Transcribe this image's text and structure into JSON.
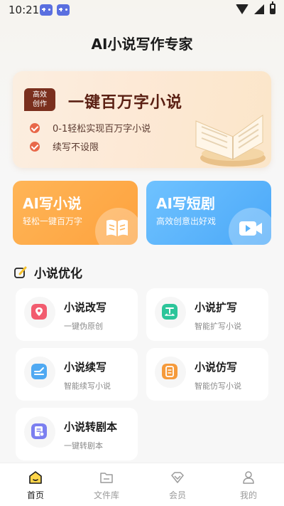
{
  "status": {
    "time": "10:21"
  },
  "header": {
    "title": "AI小说写作专家"
  },
  "banner": {
    "badge_line1": "高效",
    "badge_line2": "创作",
    "title": "一键百万字小说",
    "features": [
      "0-1轻松实现百万字小说",
      "续写不设限"
    ]
  },
  "cards": [
    {
      "title": "AI写小说",
      "subtitle": "轻松一键百万字",
      "icon": "book-icon"
    },
    {
      "title": "AI写短剧",
      "subtitle": "高效创意出好戏",
      "icon": "video-icon"
    }
  ],
  "section": {
    "title": "小说优化"
  },
  "tools": [
    {
      "name": "小说改写",
      "desc": "一键伪原创",
      "icon": "rewrite-icon",
      "color": "#f25c6f"
    },
    {
      "name": "小说扩写",
      "desc": "智能扩写小说",
      "icon": "expand-icon",
      "color": "#2cc59a"
    },
    {
      "name": "小说续写",
      "desc": "智能续写小说",
      "icon": "continue-icon",
      "color": "#4fa9f2"
    },
    {
      "name": "小说仿写",
      "desc": "智能仿写小说",
      "icon": "imitate-icon",
      "color": "#f59a3b"
    },
    {
      "name": "小说转剧本",
      "desc": "一键转剧本",
      "icon": "script-icon",
      "color": "#7b7ff0"
    }
  ],
  "nav": [
    {
      "label": "首页",
      "icon": "home-icon"
    },
    {
      "label": "文件库",
      "icon": "folder-icon"
    },
    {
      "label": "会员",
      "icon": "vip-icon"
    },
    {
      "label": "我的",
      "icon": "profile-icon"
    }
  ]
}
